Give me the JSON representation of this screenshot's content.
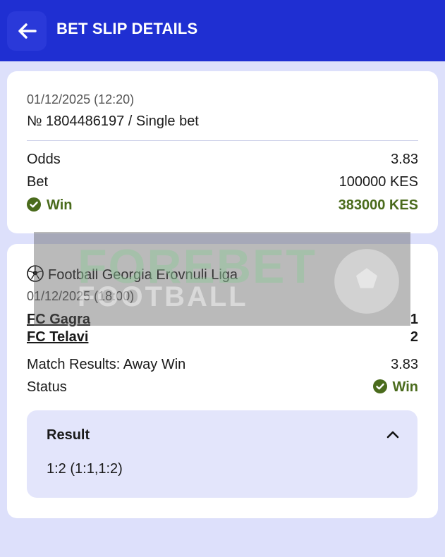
{
  "header": {
    "title": "BET SLIP DETAILS",
    "back_icon": "arrow-left-icon"
  },
  "summary": {
    "datetime": "01/12/2025 (12:20)",
    "ticket": "№ 1804486197 / Single bet",
    "odds_label": "Odds",
    "odds_value": "3.83",
    "bet_label": "Bet",
    "bet_value": "100000 KES",
    "status_label": "Win",
    "win_amount": "383000 KES"
  },
  "event": {
    "league": "Football Georgia Erovnuli Liga",
    "datetime": "01/12/2025 (18:00)",
    "home_team": "FC Gagra",
    "home_score": "1",
    "away_team": "FC Telavi",
    "away_score": "2",
    "market": "Match Results:  Away Win",
    "market_odds": "3.83",
    "status_label": "Status",
    "status_value": "Win",
    "result_title": "Result",
    "result_value": "1:2 (1:1,1:2)"
  },
  "watermark": {
    "line1": "FOREBET",
    "line2": "FOOTBALL"
  },
  "colors": {
    "header": "#1f2fd2",
    "background": "#dde0fb",
    "win": "#4a6b1c",
    "result_box": "#e3e5fb"
  }
}
